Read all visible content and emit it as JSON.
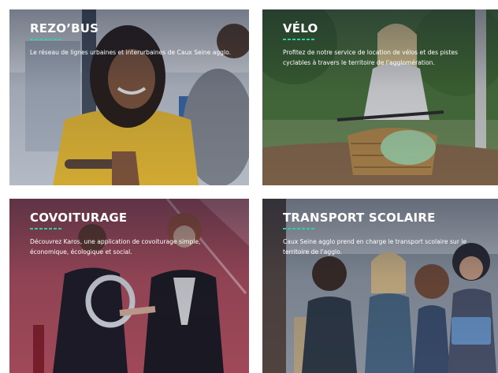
{
  "cards": [
    {
      "title": "REZO’BUS",
      "description": "Le réseau de lignes urbaines et interurbaines de Caux Seine agglo."
    },
    {
      "title": "VÉLO",
      "description": "Profitez de notre service de location de vélos et des pistes cyclables à travers le territoire de l'agglomération."
    },
    {
      "title": "COVOITURAGE",
      "description": "Découvrez Karos, une application de covoiturage simple, économique, écologique et social."
    },
    {
      "title": "TRANSPORT SCOLAIRE",
      "description": "Caux Seine agglo prend en charge le transport scolaire sur le territoire de l'agglo."
    }
  ],
  "colors": {
    "accent": "#2fd0a5",
    "text": "#ffffff"
  }
}
